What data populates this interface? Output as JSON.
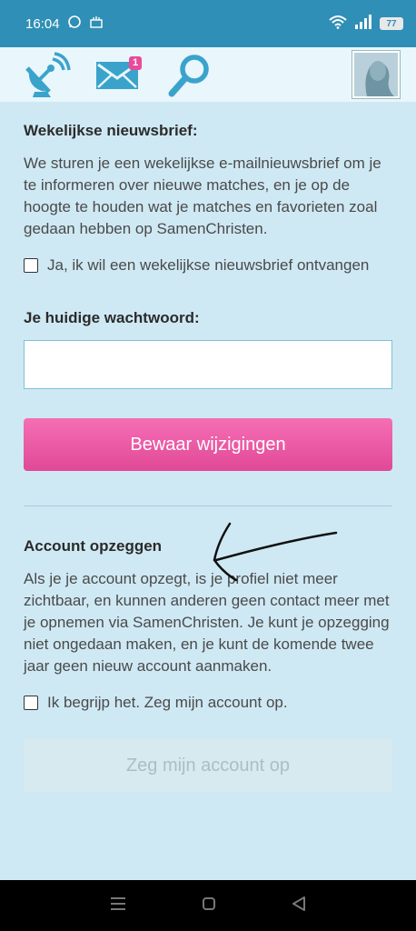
{
  "status": {
    "time": "16:04",
    "battery": "77"
  },
  "nav": {
    "messages_badge": "1"
  },
  "newsletter": {
    "heading": "Wekelijkse nieuwsbrief:",
    "description": "We sturen je een wekelijkse e-mailnieuwsbrief om je te informeren over nieuwe matches, en je op de hoogte te houden wat je matches en favorieten zoal gedaan hebben op SamenChristen.",
    "checkbox_label": "Ja, ik wil een wekelijkse nieuwsbrief ontvangen"
  },
  "password": {
    "heading": "Je huidige wachtwoord:",
    "value": ""
  },
  "save_button": "Bewaar wijzigingen",
  "cancel_account": {
    "heading": "Account opzeggen",
    "description": "Als je je account opzegt, is je profiel niet meer zichtbaar, en kunnen anderen geen contact meer met je opnemen via SamenChristen. Je kunt je opzegging niet ongedaan maken, en je kunt de komende twee jaar geen nieuw account aanmaken.",
    "checkbox_label": "Ik begrijp het. Zeg mijn account op.",
    "button": "Zeg mijn account op"
  },
  "colors": {
    "accent": "#e94a9a",
    "header": "#2f8fb6",
    "background": "#cfe9f4"
  }
}
